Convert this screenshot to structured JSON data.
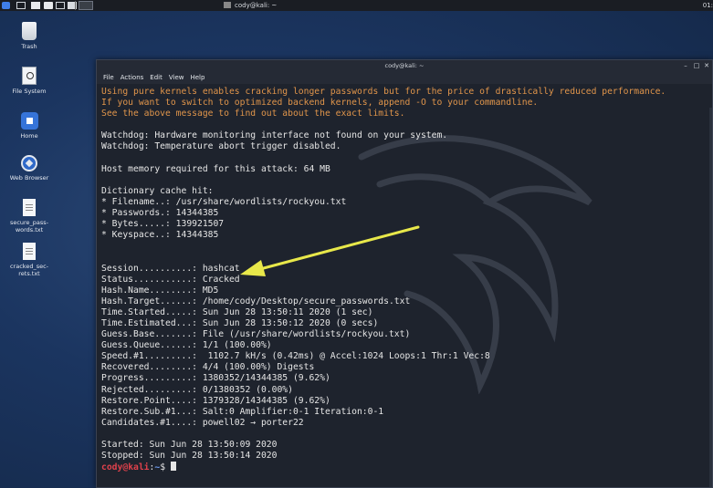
{
  "top_panel": {
    "window_title": "cody@kali: ~",
    "clock": "01:"
  },
  "desktop": {
    "icons": [
      {
        "label": "Trash",
        "icon": "trash-icon"
      },
      {
        "label": "File System",
        "icon": "drive-icon"
      },
      {
        "label": "Home",
        "icon": "home-folder-icon"
      },
      {
        "label": "Web Browser",
        "icon": "web-browser-icon"
      },
      {
        "label": "secure_pass-\nwords.txt",
        "icon": "text-file-icon"
      },
      {
        "label": "cracked_sec-\nrets.txt",
        "icon": "text-file-icon"
      }
    ]
  },
  "terminal": {
    "title": "cody@kali: ~",
    "menu": [
      "File",
      "Actions",
      "Edit",
      "View",
      "Help"
    ],
    "lines": [
      "Using pure kernels enables cracking longer passwords but for the price of drastically reduced performance.",
      "If you want to switch to optimized backend kernels, append -O to your commandline.",
      "See the above message to find out about the exact limits.",
      "",
      "Watchdog: Hardware monitoring interface not found on your system.",
      "Watchdog: Temperature abort trigger disabled.",
      "",
      "Host memory required for this attack: 64 MB",
      "",
      "Dictionary cache hit:",
      "* Filename..: /usr/share/wordlists/rockyou.txt",
      "* Passwords.: 14344385",
      "* Bytes.....: 139921507",
      "* Keyspace..: 14344385",
      "",
      "",
      "Session..........: hashcat",
      "Status...........: Cracked",
      "Hash.Name........: MD5",
      "Hash.Target......: /home/cody/Desktop/secure_passwords.txt",
      "Time.Started.....: Sun Jun 28 13:50:11 2020 (1 sec)",
      "Time.Estimated...: Sun Jun 28 13:50:12 2020 (0 secs)",
      "Guess.Base.......: File (/usr/share/wordlists/rockyou.txt)",
      "Guess.Queue......: 1/1 (100.00%)",
      "Speed.#1.........:  1102.7 kH/s (0.42ms) @ Accel:1024 Loops:1 Thr:1 Vec:8",
      "Recovered........: 4/4 (100.00%) Digests",
      "Progress.........: 1380352/14344385 (9.62%)",
      "Rejected.........: 0/1380352 (0.00%)",
      "Restore.Point....: 1379328/14344385 (9.62%)",
      "Restore.Sub.#1...: Salt:0 Amplifier:0-1 Iteration:0-1",
      "Candidates.#1....: powell02 → porter22",
      "",
      "Started: Sun Jun 28 13:50:09 2020",
      "Stopped: Sun Jun 28 13:50:14 2020"
    ],
    "warning_line_count": 3,
    "prompt": {
      "user": "cody",
      "at": "@",
      "host": "kali",
      "sep": ":",
      "path": "~",
      "symbol": "$ "
    }
  },
  "colors": {
    "warning_text": "#e0954b",
    "prompt_user": "#e0414b",
    "prompt_path": "#6e9bf0",
    "annotation_arrow": "#e8e84a"
  }
}
